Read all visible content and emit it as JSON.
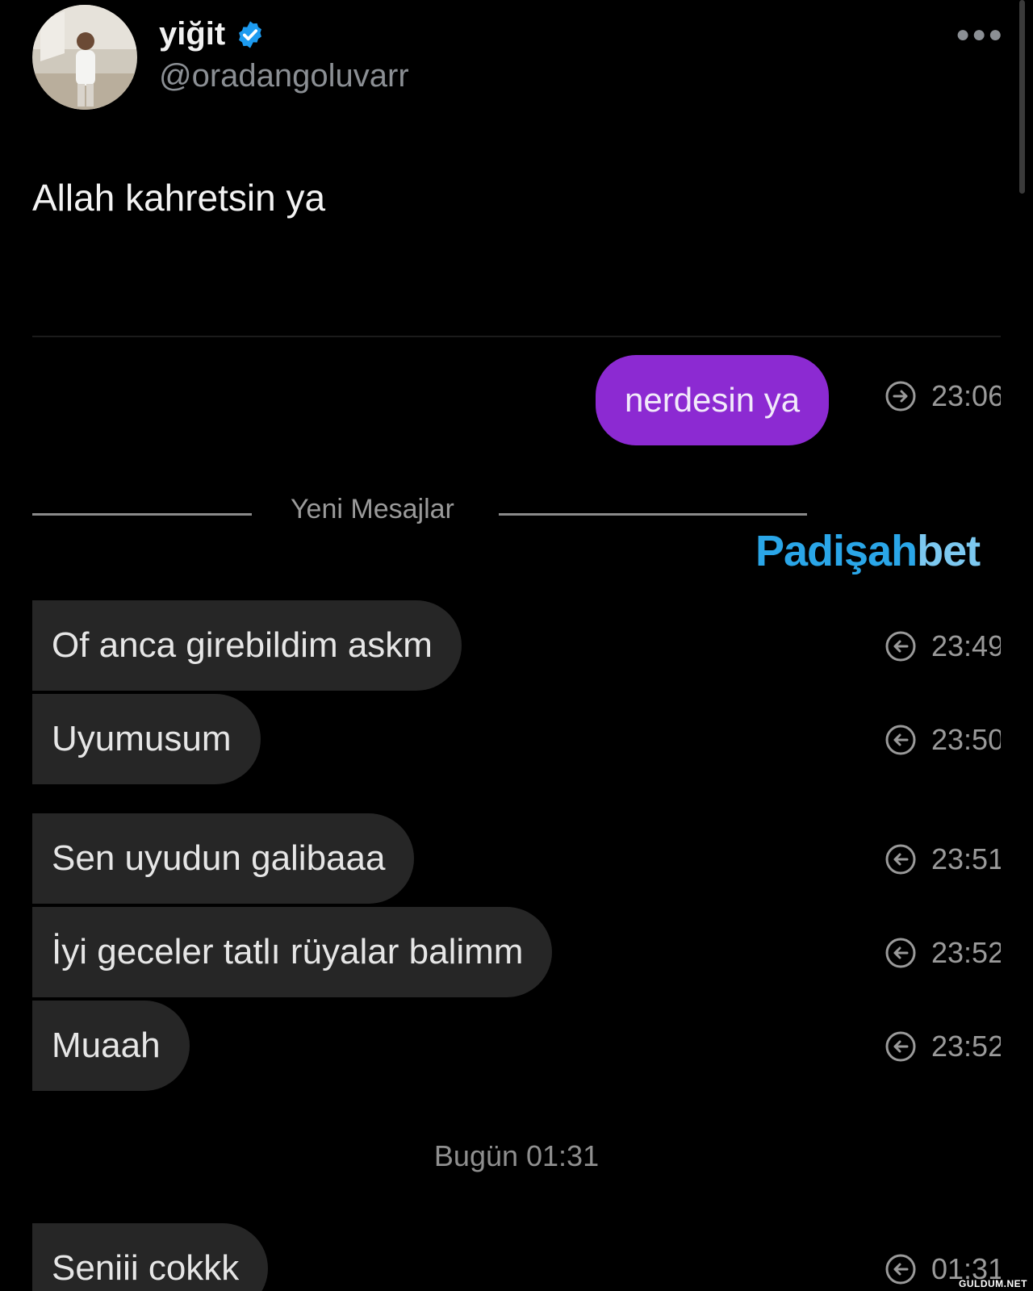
{
  "tweet": {
    "display_name": "yiğit",
    "handle": "@oradangoluvarr",
    "verified": true,
    "text": "Allah kahretsin ya",
    "more_icon": "more-horizontal-icon"
  },
  "chat": {
    "outgoing": [
      {
        "text": "nerdesin ya",
        "time": "23:06",
        "icon": "outgoing-arrow-icon"
      }
    ],
    "divider_label": "Yeni Mesajlar",
    "watermark": {
      "main": "Padişah",
      "accent": "bet"
    },
    "incoming": [
      {
        "text": "Of anca girebildim askm",
        "time": "23:49",
        "icon": "incoming-arrow-icon"
      },
      {
        "text": "Uyumusum",
        "time": "23:50",
        "icon": "incoming-arrow-icon"
      },
      {
        "text": "Sen uyudun galibaaa",
        "time": "23:51",
        "icon": "incoming-arrow-icon"
      },
      {
        "text": "İyi geceler tatlı rüyalar balimm",
        "time": "23:52",
        "icon": "incoming-arrow-icon"
      },
      {
        "text": "Muaah",
        "time": "23:52",
        "icon": "incoming-arrow-icon"
      }
    ],
    "day_label": "Bugün 01:31",
    "after_day": [
      {
        "text": "Seniii cokkk",
        "time": "01:31",
        "icon": "incoming-arrow-icon"
      }
    ]
  },
  "site_tag": "GULDUM.NET",
  "colors": {
    "background": "#000000",
    "outgoing_bubble": "#8c2ad2",
    "incoming_bubble": "#262626",
    "verified_badge": "#1d9bf0",
    "watermark": "#2aa6e8"
  }
}
